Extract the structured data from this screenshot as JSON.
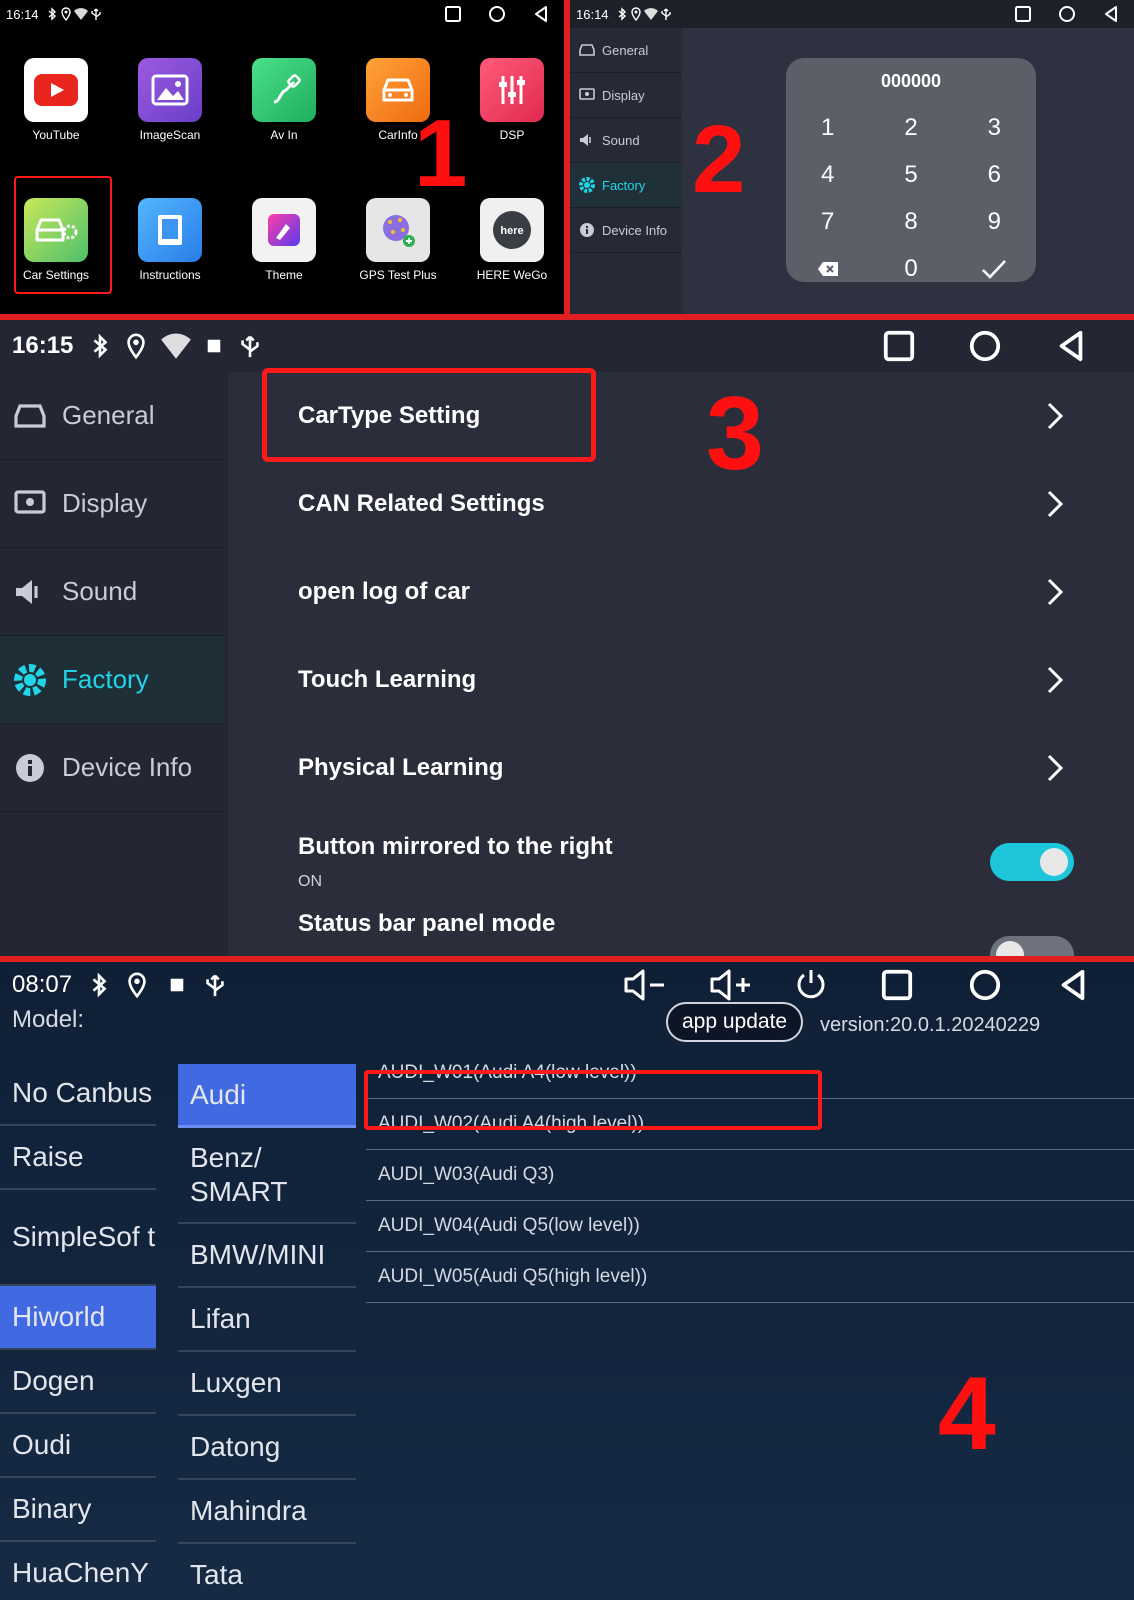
{
  "p1": {
    "time": "16:14",
    "apps": [
      {
        "label": "YouTube"
      },
      {
        "label": "ImageScan"
      },
      {
        "label": "Av In"
      },
      {
        "label": "CarInfo"
      },
      {
        "label": "DSP"
      },
      {
        "label": "Car Settings"
      },
      {
        "label": "Instructions"
      },
      {
        "label": "Theme"
      },
      {
        "label": "GPS Test Plus"
      },
      {
        "label": "HERE WeGo"
      }
    ],
    "step": "1"
  },
  "p2": {
    "time": "16:14",
    "menu": [
      "General",
      "Display",
      "Sound",
      "Factory",
      "Device Info"
    ],
    "keypad": {
      "display": "000000",
      "keys": [
        "1",
        "2",
        "3",
        "4",
        "5",
        "6",
        "7",
        "8",
        "9",
        "",
        "0",
        ""
      ]
    },
    "step": "2"
  },
  "p3": {
    "time": "16:15",
    "menu": [
      "General",
      "Display",
      "Sound",
      "Factory",
      "Device Info"
    ],
    "rows": [
      {
        "label": "CarType Setting"
      },
      {
        "label": "CAN Related Settings"
      },
      {
        "label": "open log of car"
      },
      {
        "label": "Touch Learning"
      },
      {
        "label": "Physical Learning"
      }
    ],
    "mirror": {
      "label": "Button mirrored to the right",
      "status": "ON"
    },
    "statusbar": {
      "label": "Status bar panel mode"
    },
    "step": "3"
  },
  "p4": {
    "time": "08:07",
    "model_label": "Model:",
    "app_update": "app update",
    "version": "version:20.0.1.20240229",
    "protocols": [
      "No Canbus",
      "Raise",
      "SimpleSof t",
      "Hiworld",
      "Dogen",
      "Oudi",
      "Binary",
      "HuaChenY"
    ],
    "brands": [
      "Audi",
      "Benz/ SMART",
      "BMW/MINI",
      "Lifan",
      "Luxgen",
      "Datong",
      "Mahindra",
      "Tata"
    ],
    "models": [
      "AUDI_W01(Audi A4(low level))",
      "AUDI_W02(Audi A4(high level))",
      "AUDI_W03(Audi Q3)",
      "AUDI_W04(Audi Q5(low level))",
      "AUDI_W05(Audi Q5(high level))"
    ],
    "step": "4"
  },
  "colors": {
    "accent": "#21d4e8",
    "highlight": "#4169e1",
    "annotation": "#ff1a1a"
  }
}
